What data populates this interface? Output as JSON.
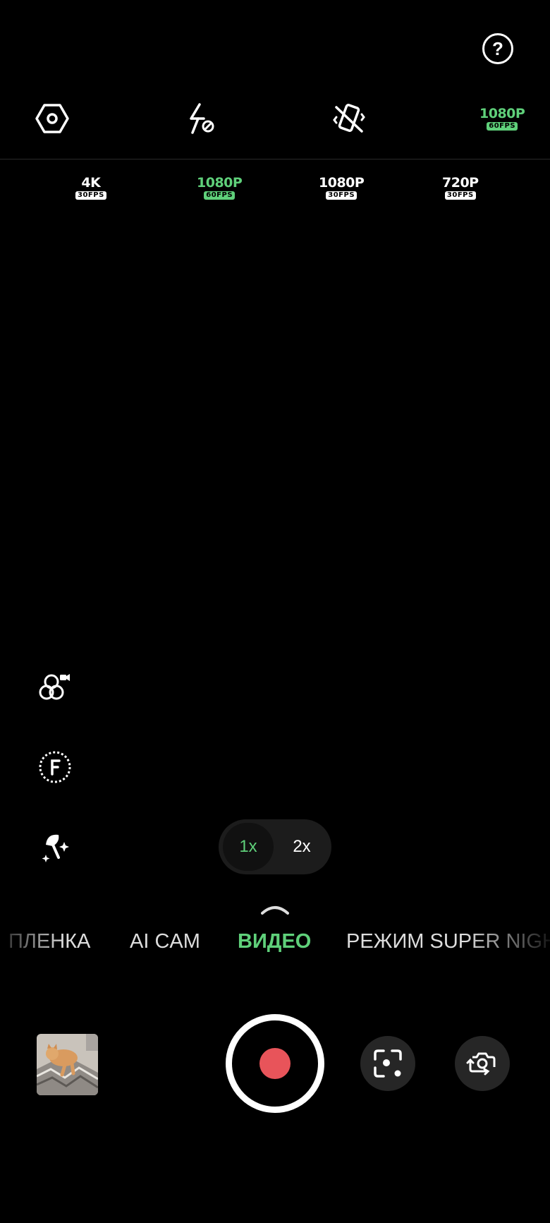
{
  "help": {
    "label": "?"
  },
  "toolbar": {
    "settings_icon": "hexagon-settings-icon",
    "flash_icon": "flash-off-icon",
    "stabilization_icon": "stabilization-off-icon",
    "current_resolution": {
      "main": "1080P",
      "fps": "60FPS"
    }
  },
  "resolution_options": [
    {
      "main": "4K",
      "fps": "30FPS",
      "active": false
    },
    {
      "main": "1080P",
      "fps": "60FPS",
      "active": true
    },
    {
      "main": "1080P",
      "fps": "30FPS",
      "active": false
    },
    {
      "main": "720P",
      "fps": "30FPS",
      "active": false
    }
  ],
  "side_tools": [
    "filters-video-icon",
    "filmic-f-icon",
    "beauty-wand-icon"
  ],
  "zoom": {
    "options": [
      "1x",
      "2x"
    ],
    "active": "1x"
  },
  "modes": [
    "ПЛЕНКА",
    "AI CAM",
    "ВИДЕО",
    "РЕЖИМ SUPER NIGHT"
  ],
  "active_mode": "ВИДЕО",
  "bottom": {
    "gallery_thumbnail": "cat-photo-thumbnail",
    "record_icon": "record-icon",
    "google_lens_icon": "lens-icon",
    "switch_camera_icon": "switch-camera-icon"
  },
  "colors": {
    "accent": "#5fd07a",
    "record": "#e8545a",
    "background": "#000000"
  }
}
